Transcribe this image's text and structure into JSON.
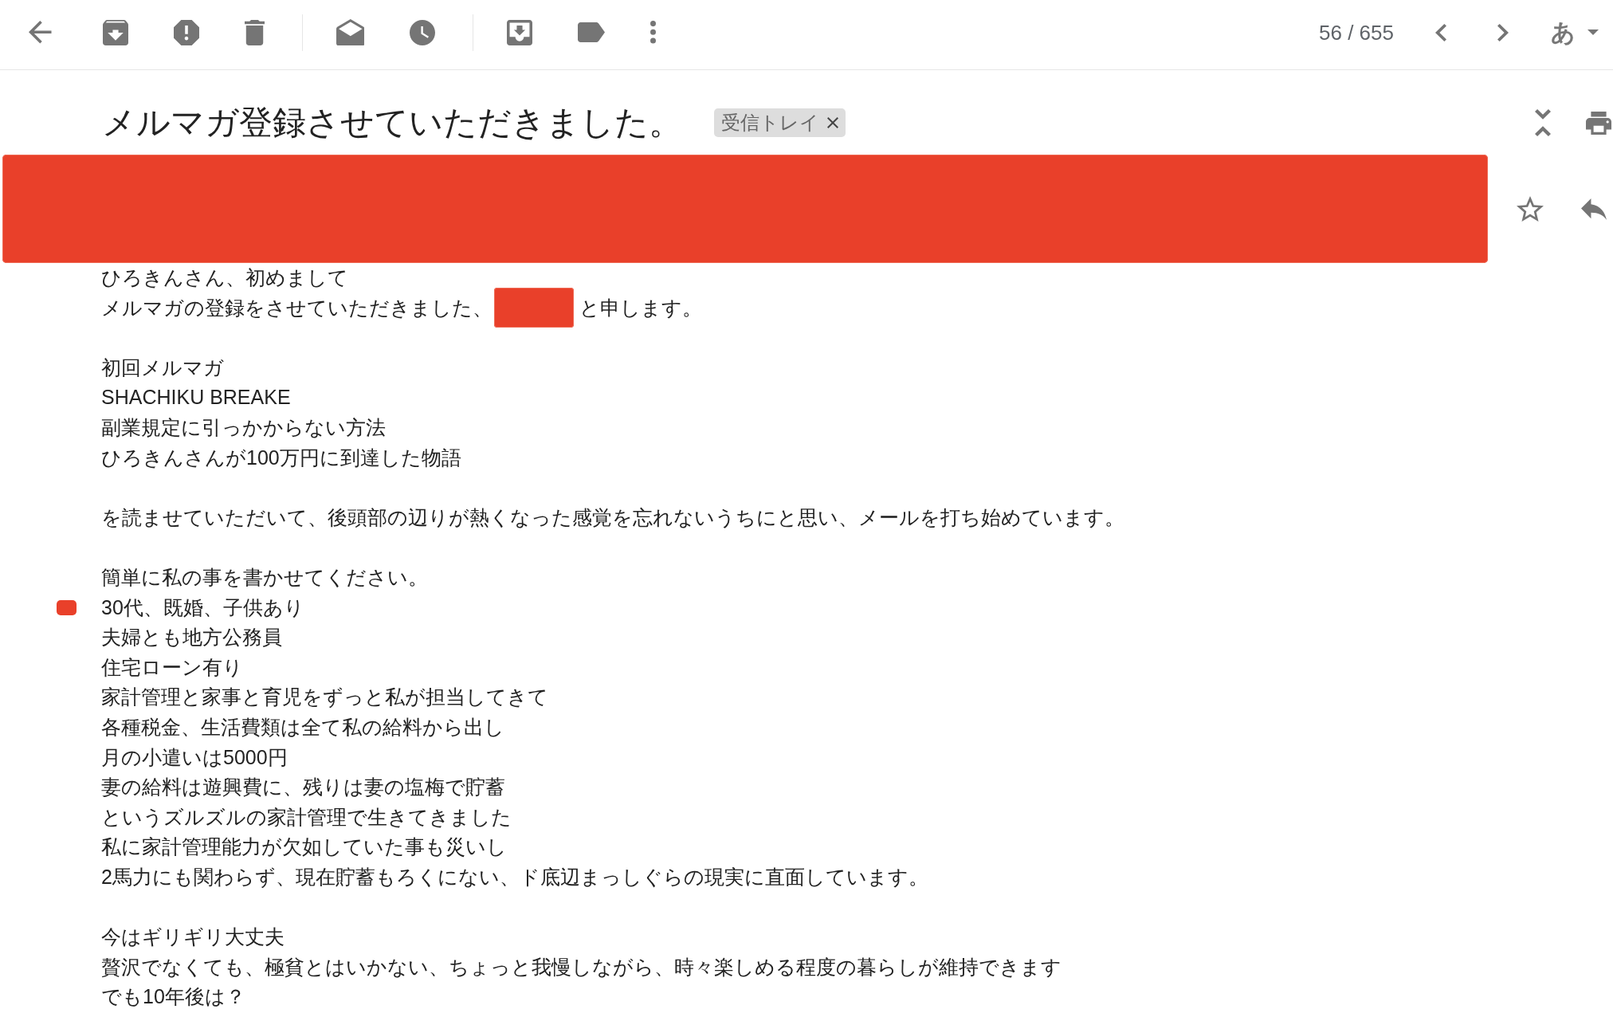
{
  "toolbar": {
    "counter": "56 / 655",
    "input_tool": "あ"
  },
  "message": {
    "subject": "メルマガ登録させていただきました。",
    "labels": [
      {
        "text": "受信トレイ"
      }
    ],
    "starred": false,
    "body": {
      "paragraphs": [
        {
          "lines": [
            {
              "kind": "plain",
              "text": "ひろきんさん、初めまして",
              "marked": false
            },
            {
              "kind": "redacted",
              "before": "メルマガの登録をさせていただきました、",
              "after": "と申します。",
              "marked": false
            }
          ]
        },
        {
          "lines": [
            {
              "kind": "plain",
              "text": "初回メルマガ",
              "marked": false
            },
            {
              "kind": "plain",
              "text": "SHACHIKU BREAKE",
              "marked": false
            },
            {
              "kind": "plain",
              "text": "副業規定に引っかからない方法",
              "marked": false
            },
            {
              "kind": "plain",
              "text": "ひろきんさんが100万円に到達した物語",
              "marked": false
            }
          ]
        },
        {
          "lines": [
            {
              "kind": "plain",
              "text": "を読ませていただいて、後頭部の辺りが熱くなった感覚を忘れないうちにと思い、メールを打ち始めています。",
              "marked": false
            }
          ]
        },
        {
          "lines": [
            {
              "kind": "plain",
              "text": "簡単に私の事を書かせてください。",
              "marked": false
            },
            {
              "kind": "plain",
              "text": "30代、既婚、子供あり",
              "marked": true
            },
            {
              "kind": "plain",
              "text": "夫婦とも地方公務員",
              "marked": false
            },
            {
              "kind": "plain",
              "text": "住宅ローン有り",
              "marked": false
            },
            {
              "kind": "plain",
              "text": "家計管理と家事と育児をずっと私が担当してきて",
              "marked": false
            },
            {
              "kind": "plain",
              "text": "各種税金、生活費類は全て私の給料から出し",
              "marked": false
            },
            {
              "kind": "plain",
              "text": "月の小遣いは5000円",
              "marked": false
            },
            {
              "kind": "plain",
              "text": "妻の給料は遊興費に、残りは妻の塩梅で貯蓄",
              "marked": false
            },
            {
              "kind": "plain",
              "text": "というズルズルの家計管理で生きてきました",
              "marked": false
            },
            {
              "kind": "plain",
              "text": "私に家計管理能力が欠如していた事も災いし",
              "marked": false
            },
            {
              "kind": "plain",
              "text": "2馬力にも関わらず、現在貯蓄もろくにない、ド底辺まっしぐらの現実に直面しています。",
              "marked": false
            }
          ]
        },
        {
          "lines": [
            {
              "kind": "plain",
              "text": "今はギリギリ大丈夫",
              "marked": false
            },
            {
              "kind": "plain",
              "text": "贅沢でなくても、極貧とはいかない、ちょっと我慢しながら、時々楽しめる程度の暮らしが維持できます",
              "marked": false
            },
            {
              "kind": "plain",
              "text": "でも10年後は？",
              "marked": false
            }
          ]
        }
      ]
    }
  }
}
